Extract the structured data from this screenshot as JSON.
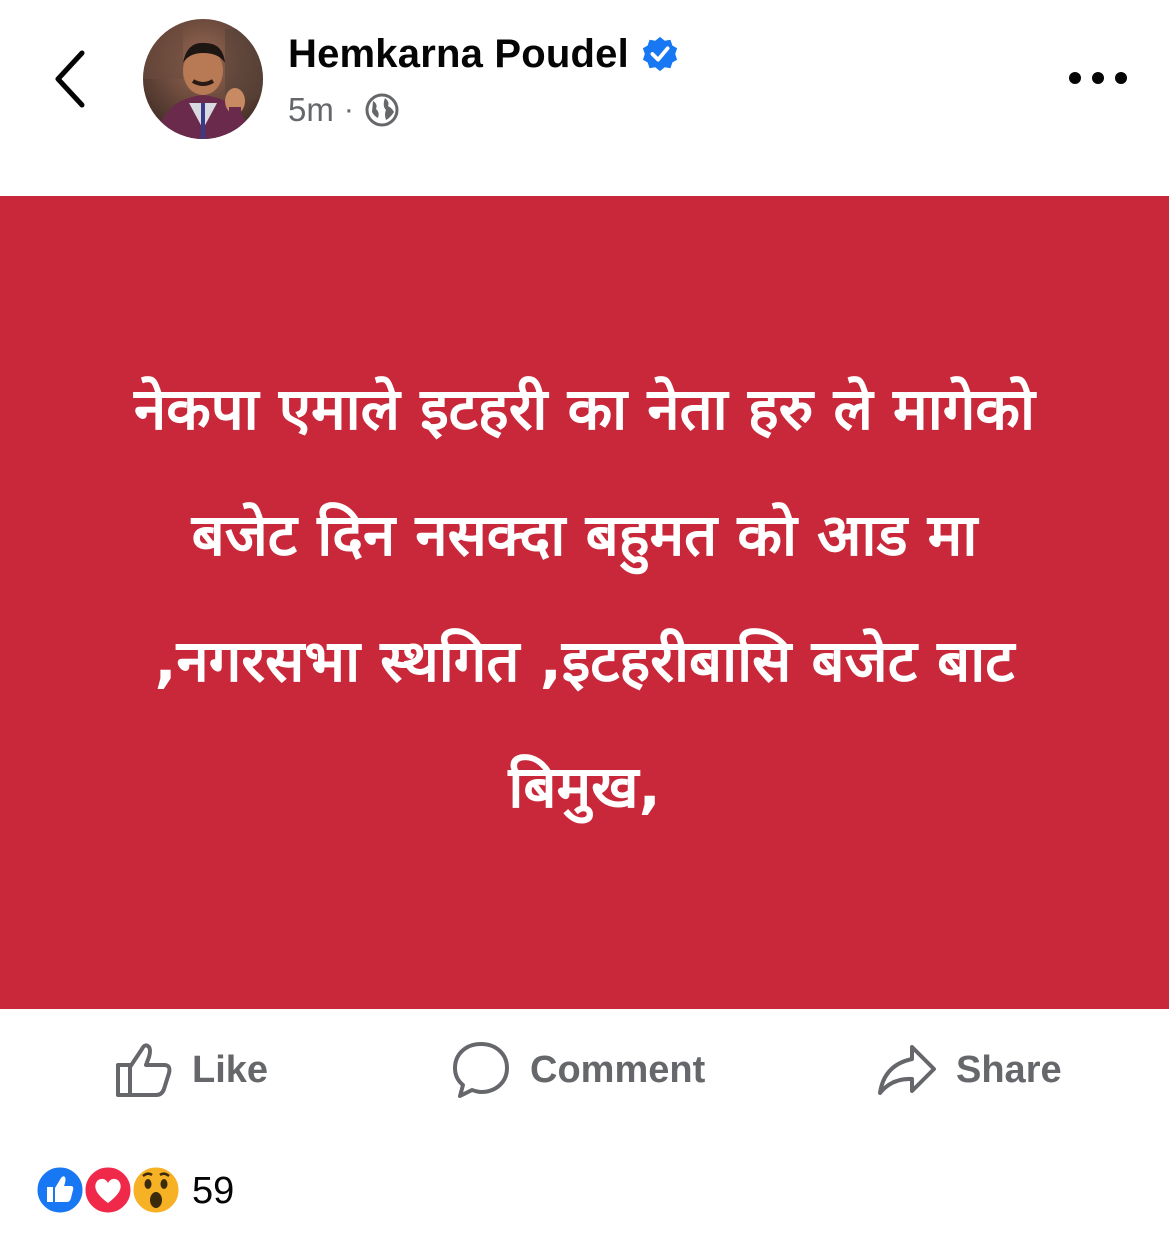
{
  "header": {
    "back_icon": "chevron-left-icon",
    "author_name": "Hemkarna Poudel",
    "verified_icon": "verified-badge-icon",
    "time": "5m",
    "separator": "·",
    "audience_icon": "globe-icon",
    "more_icon": "more-horizontal-icon"
  },
  "post": {
    "background_color": "#c9283a",
    "text_color": "#ffffff",
    "text": "नेकपा एमाले इटहरी का नेता हरु ले मागेको बजेट दिन नसक्दा बहुमत को आड मा ,नगरसभा स्थगित ,इटहरीबासि बजेट बाट बिमुख,"
  },
  "actions": {
    "like_label": "Like",
    "comment_label": "Comment",
    "share_label": "Share"
  },
  "reactions": {
    "icons": [
      "like-reaction-icon",
      "love-reaction-icon",
      "wow-reaction-icon"
    ],
    "count": "59",
    "like_color": "#1877f2",
    "love_color": "#f02849",
    "wow_color": "#f7b125"
  },
  "colors": {
    "accent": "#1877f2",
    "muted_text": "#65676b"
  }
}
